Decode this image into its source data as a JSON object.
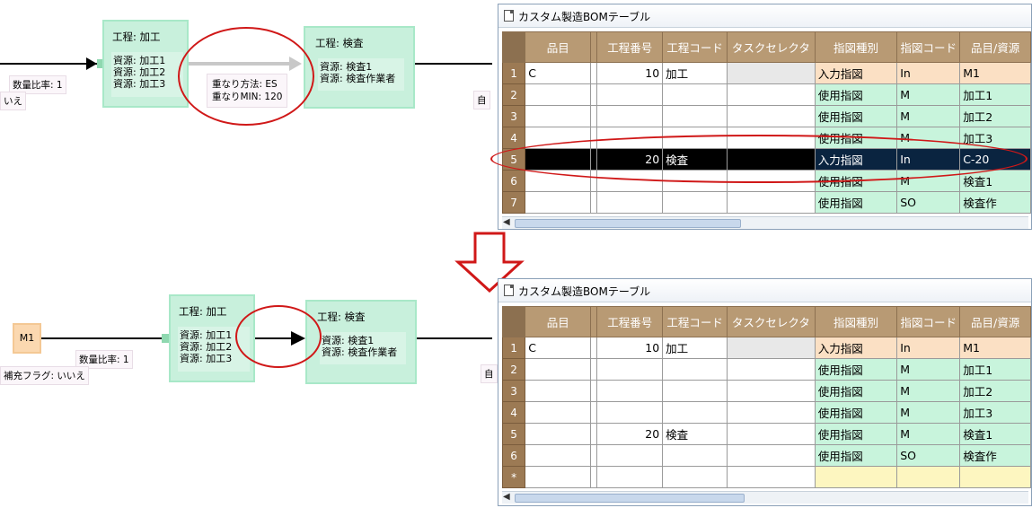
{
  "top_diagram": {
    "process1": {
      "title": "工程: 加工",
      "resources": [
        "資源: 加工1",
        "資源: 加工2",
        "資源: 加工3"
      ]
    },
    "process2": {
      "title": "工程: 検査",
      "resources": [
        "資源: 検査1",
        "資源: 検査作業者"
      ]
    },
    "quantity_ratio": "数量比率: 1",
    "left_tag_partial": "いえ",
    "right_tag_partial": "自",
    "overlap": {
      "method": "重なり方法: ES",
      "min": "重なりMIN: 120"
    }
  },
  "bottom_diagram": {
    "item_node": "M1",
    "process1": {
      "title": "工程: 加工",
      "resources": [
        "資源: 加工1",
        "資源: 加工2",
        "資源: 加工3"
      ]
    },
    "process2": {
      "title": "工程: 検査",
      "resources": [
        "資源: 検査1",
        "資源: 検査作業者"
      ]
    },
    "quantity_ratio": "数量比率: 1",
    "replenish_flag": "補充フラグ: いいえ",
    "right_tag_partial": "自"
  },
  "window_title": "カスタム製造BOMテーブル",
  "columns": [
    "品目",
    "工程番号",
    "工程コード",
    "タスクセレクタ",
    "指図種別",
    "指図コード",
    "品目/資源"
  ],
  "top_table": {
    "rows": [
      {
        "num": "1",
        "item": "C",
        "proc_no": "10",
        "proc_code": "加工",
        "type": "入力指図",
        "code": "In",
        "res": "M1"
      },
      {
        "num": "2",
        "item": "",
        "proc_no": "",
        "proc_code": "",
        "type": "使用指図",
        "code": "M",
        "res": "加工1"
      },
      {
        "num": "3",
        "item": "",
        "proc_no": "",
        "proc_code": "",
        "type": "使用指図",
        "code": "M",
        "res": "加工2"
      },
      {
        "num": "4",
        "item": "",
        "proc_no": "",
        "proc_code": "",
        "type": "使用指図",
        "code": "M",
        "res": "加工3"
      },
      {
        "num": "5",
        "item": "",
        "proc_no": "20",
        "proc_code": "検査",
        "type": "入力指図",
        "code": "In",
        "res": "C-20"
      },
      {
        "num": "6",
        "item": "",
        "proc_no": "",
        "proc_code": "",
        "type": "使用指図",
        "code": "M",
        "res": "検査1"
      },
      {
        "num": "7",
        "item": "",
        "proc_no": "",
        "proc_code": "",
        "type": "使用指図",
        "code": "SO",
        "res": "検査作"
      }
    ]
  },
  "bottom_table": {
    "rows": [
      {
        "num": "1",
        "item": "C",
        "proc_no": "10",
        "proc_code": "加工",
        "type": "入力指図",
        "code": "In",
        "res": "M1"
      },
      {
        "num": "2",
        "item": "",
        "proc_no": "",
        "proc_code": "",
        "type": "使用指図",
        "code": "M",
        "res": "加工1"
      },
      {
        "num": "3",
        "item": "",
        "proc_no": "",
        "proc_code": "",
        "type": "使用指図",
        "code": "M",
        "res": "加工2"
      },
      {
        "num": "4",
        "item": "",
        "proc_no": "",
        "proc_code": "",
        "type": "使用指図",
        "code": "M",
        "res": "加工3"
      },
      {
        "num": "5",
        "item": "",
        "proc_no": "20",
        "proc_code": "検査",
        "type": "使用指図",
        "code": "M",
        "res": "検査1"
      },
      {
        "num": "6",
        "item": "",
        "proc_no": "",
        "proc_code": "",
        "type": "使用指図",
        "code": "SO",
        "res": "検査作"
      }
    ],
    "new_row_marker": "*"
  },
  "colors": {
    "highlight": "#d01818",
    "header": "#b89a74",
    "rownum": "#9c7a54",
    "node": "#c8f0dc",
    "input_order": "#fbe0c4",
    "use_order": "#c8f4dc"
  }
}
